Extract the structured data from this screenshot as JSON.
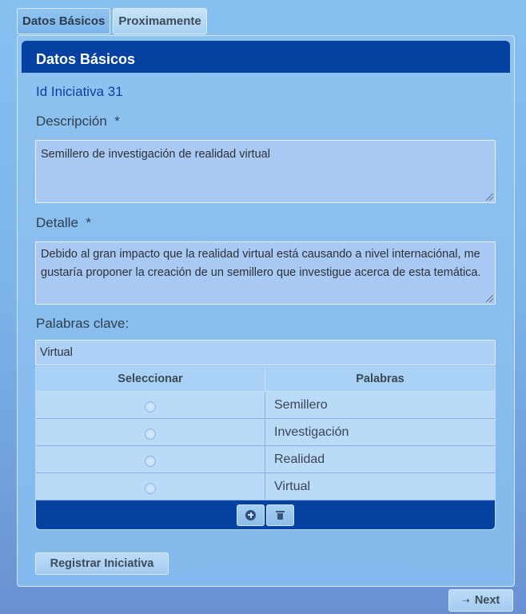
{
  "tabs": [
    {
      "label": "Datos Básicos",
      "active": true
    },
    {
      "label": "Proximamente",
      "active": false
    }
  ],
  "panel": {
    "title": "Datos Básicos"
  },
  "iniciativa": {
    "id_text": "Id Iniciativa 31"
  },
  "descripcion": {
    "label": "Descripción",
    "required_mark": "*",
    "value": "Semillero de investigación de realidad virtual"
  },
  "detalle": {
    "label": "Detalle",
    "required_mark": "*",
    "value": "Debido al gran impacto que la realidad virtual está causando a nivel internaciónal, me gustaría proponer la creación de un semillero que investigue acerca de esta temática."
  },
  "palabras_clave": {
    "label": "Palabras clave:",
    "input_value": "Virtual",
    "columns": [
      "Seleccionar",
      "Palabras"
    ],
    "rows": [
      "Semillero",
      "Investigación",
      "Realidad",
      "Virtual"
    ],
    "footer_icons": [
      "plus-circle-icon",
      "trash-icon"
    ]
  },
  "actions": {
    "register_label": "Registrar Iniciativa",
    "next_label": "Next",
    "next_icon": "arrow-right-icon"
  },
  "colors": {
    "header_bg": "#0541a0",
    "page_bg": "#7db5ea",
    "id_text": "#0a3ea6"
  }
}
